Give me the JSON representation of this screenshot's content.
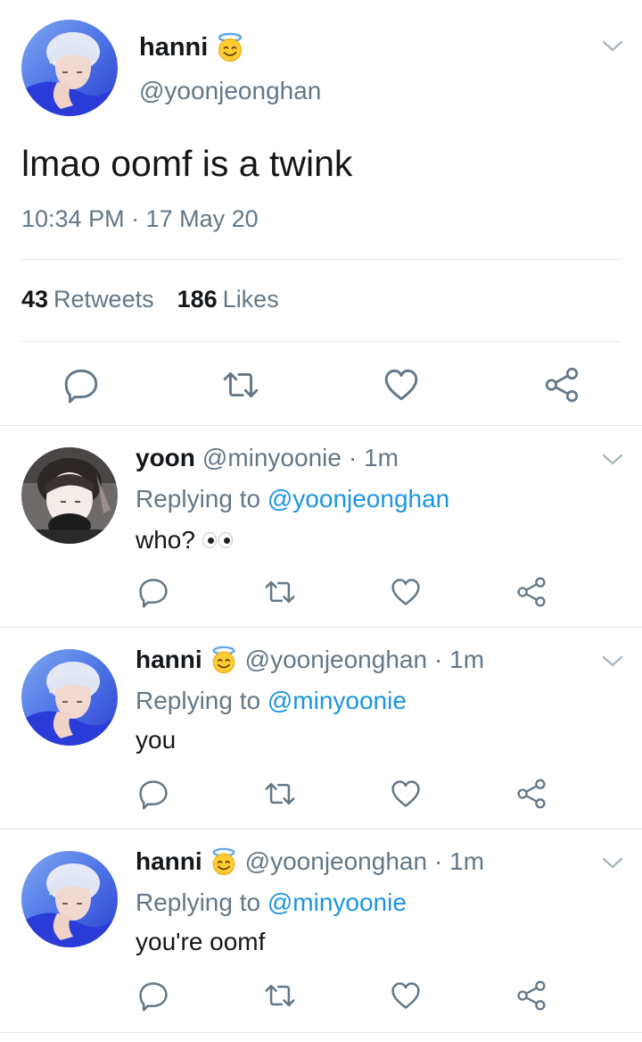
{
  "main_tweet": {
    "name": "hanni",
    "name_emoji": "smiling-face-with-halo",
    "handle": "@yoonjeonghan",
    "text": "lmao oomf is a twink",
    "timestamp": "10:34 PM · 17 May 20",
    "retweets_count": "43",
    "retweets_label": "Retweets",
    "likes_count": "186",
    "likes_label": "Likes",
    "actions": [
      "reply-icon",
      "retweet-icon",
      "like-icon",
      "share-icon"
    ]
  },
  "replies": [
    {
      "name": "yoon",
      "handle": "@minyoonie",
      "time": "· 1m",
      "replying_prefix": "Replying to",
      "replying_to": "@yoonjeonghan",
      "text": "who?",
      "emoji": "eyes"
    },
    {
      "name": "hanni",
      "name_emoji": "smiling-face-with-halo",
      "handle": "@yoonjeonghan",
      "time": "· 1m",
      "replying_prefix": "Replying to",
      "replying_to": "@minyoonie",
      "text": "you"
    },
    {
      "name": "hanni",
      "name_emoji": "smiling-face-with-halo",
      "handle": "@yoonjeonghan",
      "time": "· 1m",
      "replying_prefix": "Replying to",
      "replying_to": "@minyoonie",
      "text": "you're oomf"
    }
  ],
  "colors": {
    "text_primary": "#14171a",
    "text_secondary": "#657786",
    "mention_blue": "#1b95e0",
    "divider": "#e1e8ed"
  }
}
